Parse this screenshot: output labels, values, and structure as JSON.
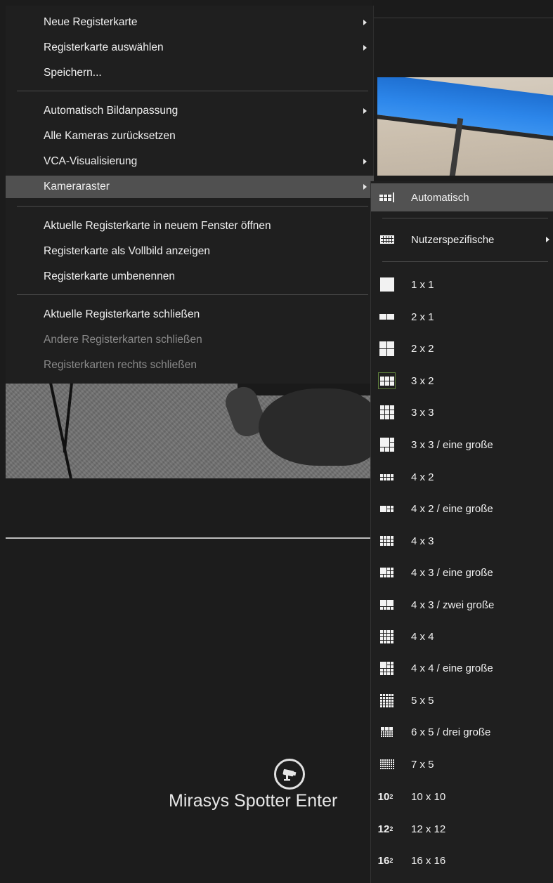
{
  "main_menu": {
    "items": [
      {
        "label": "Neue Registerkarte",
        "submenu": true
      },
      {
        "label": "Registerkarte auswählen",
        "submenu": true
      },
      {
        "label": "Speichern...",
        "submenu": false
      },
      {
        "label": "Automatisch Bildanpassung",
        "submenu": true
      },
      {
        "label": "Alle Kameras zurücksetzen",
        "submenu": false
      },
      {
        "label": "VCA-Visualisierung",
        "submenu": true
      },
      {
        "label": "Kameraraster",
        "submenu": true,
        "active": true
      },
      {
        "label": "Aktuelle Registerkarte in neuem Fenster öffnen",
        "submenu": false
      },
      {
        "label": "Registerkarte als Vollbild anzeigen",
        "submenu": false
      },
      {
        "label": "Registerkarte umbenennen",
        "submenu": false
      },
      {
        "label": "Aktuelle Registerkarte schließen",
        "submenu": false
      },
      {
        "label": "Andere Registerkarten schließen",
        "submenu": false,
        "disabled": true
      },
      {
        "label": "Registerkarten rechts schließen",
        "submenu": false,
        "disabled": true
      }
    ]
  },
  "camera_grid_menu": {
    "items": [
      {
        "label": "Automatisch",
        "icon": "auto-grid-icon",
        "highlighted": true
      },
      {
        "label": "Nutzerspezifische",
        "icon": "custom-grid-icon",
        "submenu": true
      },
      {
        "label": "1 x 1",
        "icon": "grid-1x1-icon"
      },
      {
        "label": "2 x 1",
        "icon": "grid-2x1-icon"
      },
      {
        "label": "2 x 2",
        "icon": "grid-2x2-icon"
      },
      {
        "label": "3 x 2",
        "icon": "grid-3x2-icon",
        "selected": true
      },
      {
        "label": "3 x 3",
        "icon": "grid-3x3-icon"
      },
      {
        "label": "3 x 3 / eine große",
        "icon": "grid-3x3-one-large-icon"
      },
      {
        "label": "4 x 2",
        "icon": "grid-4x2-icon"
      },
      {
        "label": "4 x 2 / eine große",
        "icon": "grid-4x2-one-large-icon"
      },
      {
        "label": "4 x 3",
        "icon": "grid-4x3-icon"
      },
      {
        "label": "4 x 3 / eine große",
        "icon": "grid-4x3-one-large-icon"
      },
      {
        "label": "4 x 3 / zwei große",
        "icon": "grid-4x3-two-large-icon"
      },
      {
        "label": "4 x 4",
        "icon": "grid-4x4-icon"
      },
      {
        "label": "4 x 4 / eine große",
        "icon": "grid-4x4-one-large-icon"
      },
      {
        "label": "5 x 5",
        "icon": "grid-5x5-icon"
      },
      {
        "label": "6 x 5 / drei große",
        "icon": "grid-6x5-three-large-icon"
      },
      {
        "label": "7 x 5",
        "icon": "grid-7x5-icon"
      },
      {
        "label": "10 x 10",
        "icon": "grid-10x10-icon",
        "icon_text": "10",
        "icon_sup": "2"
      },
      {
        "label": "12 x 12",
        "icon": "grid-12x12-icon",
        "icon_text": "12",
        "icon_sup": "2"
      },
      {
        "label": "16 x 16",
        "icon": "grid-16x16-icon",
        "icon_text": "16",
        "icon_sup": "2"
      }
    ]
  },
  "branding": {
    "text": "Mirasys Spotter Enter",
    "icon": "surveillance-camera-icon"
  },
  "colors": {
    "menu_bg": "#1f1f1f",
    "active_item_bg": "#505050",
    "selected_frame": "#5d7e3a",
    "disabled_text": "#8a8a8a"
  }
}
